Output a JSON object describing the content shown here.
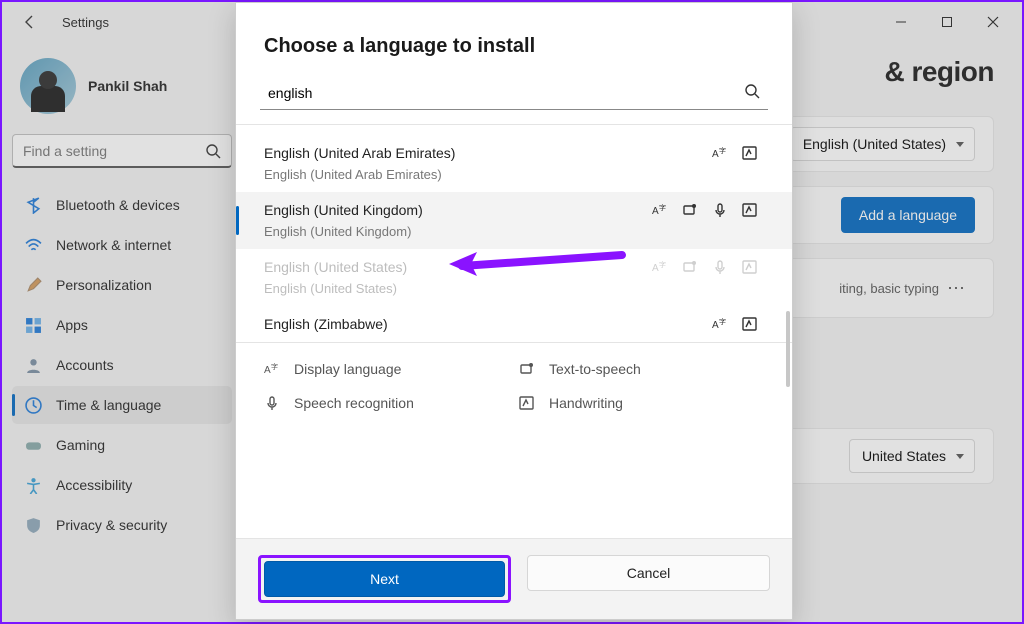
{
  "window": {
    "title": "Settings"
  },
  "profile": {
    "name": "Pankil Shah"
  },
  "sidebar": {
    "search_placeholder": "Find a setting",
    "items": [
      {
        "label": "Bluetooth & devices"
      },
      {
        "label": "Network & internet"
      },
      {
        "label": "Personalization"
      },
      {
        "label": "Apps"
      },
      {
        "label": "Accounts"
      },
      {
        "label": "Time & language"
      },
      {
        "label": "Gaming"
      },
      {
        "label": "Accessibility"
      },
      {
        "label": "Privacy & security"
      }
    ]
  },
  "page": {
    "heading_suffix": "& region",
    "current_language": "English (United States)",
    "add_language_label": "Add a language",
    "pack_hint": "iting, basic typing",
    "region_value": "United States"
  },
  "modal": {
    "title": "Choose a language to install",
    "search_value": "english",
    "rows": [
      {
        "primary": "English (United Arab Emirates)",
        "secondary": "English (United Arab Emirates)",
        "features": [
          "display",
          "handwriting"
        ]
      },
      {
        "primary": "English (United Kingdom)",
        "secondary": "English (United Kingdom)",
        "features": [
          "display",
          "tts",
          "speech",
          "handwriting"
        ],
        "selected": true
      },
      {
        "primary": "English (United States)",
        "secondary": "English (United States)",
        "features": [
          "display",
          "tts",
          "speech",
          "handwriting"
        ],
        "disabled": true
      },
      {
        "primary": "English (Zimbabwe)",
        "secondary": "",
        "features": [
          "display",
          "handwriting"
        ]
      }
    ],
    "legend": {
      "display": "Display language",
      "tts": "Text-to-speech",
      "speech": "Speech recognition",
      "handwriting": "Handwriting"
    },
    "next": "Next",
    "cancel": "Cancel"
  }
}
